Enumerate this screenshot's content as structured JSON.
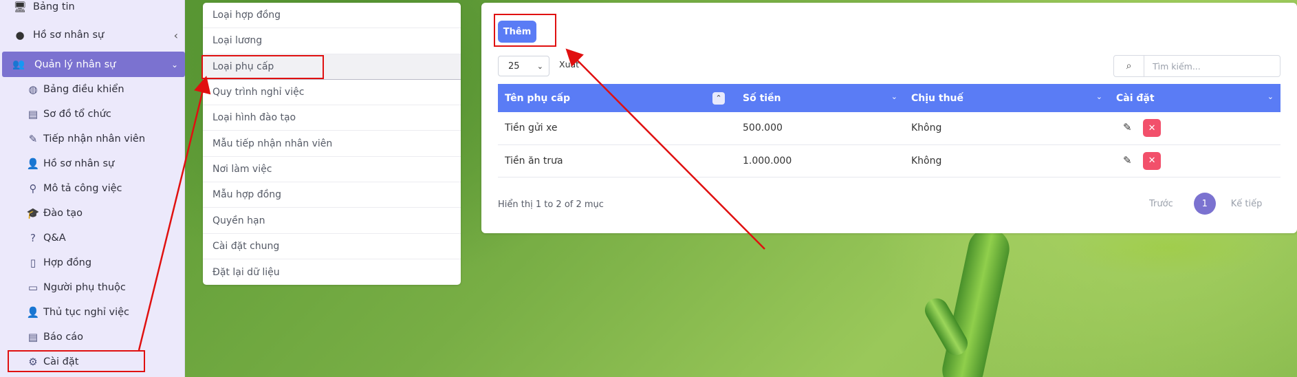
{
  "sidebar": {
    "top_items": [
      {
        "label": "Bảng tin",
        "icon": "monitor-icon"
      },
      {
        "label": "Hồ sơ nhân sự",
        "icon": "user-circle-icon"
      }
    ],
    "active_section": {
      "label": "Quản lý nhân sự",
      "icon": "users-icon"
    },
    "sub_items": [
      {
        "label": "Bảng điều khiển",
        "icon": "dashboard-icon"
      },
      {
        "label": "Sơ đồ tổ chức",
        "icon": "list-table-icon"
      },
      {
        "label": "Tiếp nhận nhân viên",
        "icon": "edit-icon"
      },
      {
        "label": "Hồ sơ nhân sự",
        "icon": "user-icon"
      },
      {
        "label": "Mô tả công việc",
        "icon": "pin-icon"
      },
      {
        "label": "Đào tạo",
        "icon": "graduation-cap-icon"
      },
      {
        "label": "Q&A",
        "icon": "question-icon"
      },
      {
        "label": "Hợp đồng",
        "icon": "file-contract-icon"
      },
      {
        "label": "Người phụ thuộc",
        "icon": "id-card-icon"
      },
      {
        "label": "Thủ tục nghỉ việc",
        "icon": "user-remove-icon"
      },
      {
        "label": "Báo cáo",
        "icon": "report-list-icon"
      },
      {
        "label": "Cài đặt",
        "icon": "gears-icon"
      }
    ]
  },
  "settings_menu": [
    "Loại hợp đồng",
    "Loại lương",
    "Loại phụ cấp",
    "Quy trình nghỉ việc",
    "Loại hình đào tạo",
    "Mẫu tiếp nhận nhân viên",
    "Nơi làm việc",
    "Mẫu hợp đồng",
    "Quyền hạn",
    "Cài đặt chung",
    "Đặt lại dữ liệu"
  ],
  "settings_menu_active_index": 2,
  "main": {
    "add_button": "Thêm",
    "page_size": "25",
    "export_label": "Xuất",
    "search_placeholder": "Tìm kiếm...",
    "columns": [
      "Tên phụ cấp",
      "Số tiền",
      "Chịu thuế",
      "Cài đặt"
    ],
    "rows": [
      {
        "name": "Tiền gửi xe",
        "amount": "500.000",
        "taxable": "Không"
      },
      {
        "name": "Tiền ăn trưa",
        "amount": "1.000.000",
        "taxable": "Không"
      }
    ],
    "info_text": "Hiển thị 1 to 2 of 2 mục",
    "pager": {
      "prev": "Trước",
      "current": "1",
      "next": "Kế tiếp"
    }
  },
  "colors": {
    "accent_blue": "#5a7cf5",
    "accent_purple": "#7b72d0",
    "delete_red": "#f2506b",
    "annotation_red": "#e01010"
  }
}
